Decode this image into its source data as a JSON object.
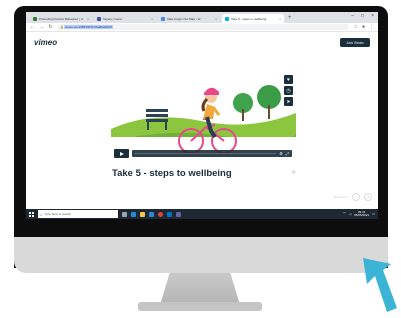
{
  "browser": {
    "tabs": [
      {
        "label": "Promoting Positive Behaviour | U",
        "fav_color": "#2e7d32",
        "active": false
      },
      {
        "label": "Tapety | Caxto",
        "fav_color": "#3f51b5",
        "active": false
      },
      {
        "label": "Take Kings! Our Map - W",
        "fav_color": "#4285f4",
        "active": false
      },
      {
        "label": "Take 5 - steps to wellbeing",
        "fav_color": "#00adef",
        "active": true
      }
    ],
    "new_tab": "+",
    "window_controls": [
      "–",
      "□",
      "×"
    ],
    "url": "vimeo.com/482700717/ba8ba0f9d7"
  },
  "vimeo": {
    "logo": "vimeo",
    "join_button": "Join Vimeo"
  },
  "video": {
    "title": "Take 5 - steps to wellbeing",
    "progress": 0.01,
    "side_icons": [
      "heart-icon",
      "clock-icon",
      "share-icon"
    ]
  },
  "page": {
    "faint_link": "More from..."
  },
  "taskbar": {
    "search_placeholder": "Type here to search",
    "time": "09:41",
    "date": "05/05/2021"
  },
  "colors": {
    "accent": "#00adef",
    "vimeo_dark": "#1a2e3b",
    "arrow": "#3cb4d6"
  }
}
